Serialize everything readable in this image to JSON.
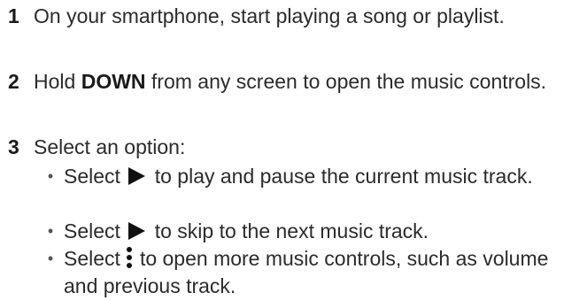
{
  "steps": [
    {
      "number": "1",
      "text": "On your smartphone, start playing a song or playlist."
    },
    {
      "number": "2",
      "text_before": "Hold ",
      "bold": "DOWN",
      "text_after": " from any screen to open the music controls."
    },
    {
      "number": "3",
      "text": "Select an option:"
    }
  ],
  "options": [
    {
      "prefix": "Select",
      "icon": "play-icon",
      "suffix": "to play and pause the current music track."
    },
    {
      "prefix": "Select",
      "icon": "next-track-icon",
      "suffix": "to skip to the next music track."
    },
    {
      "prefix": "Select",
      "icon": "more-vertical-dots-icon",
      "suffix": "to open more music controls, such as volume and previous track."
    }
  ],
  "bullet_glyph": "•"
}
